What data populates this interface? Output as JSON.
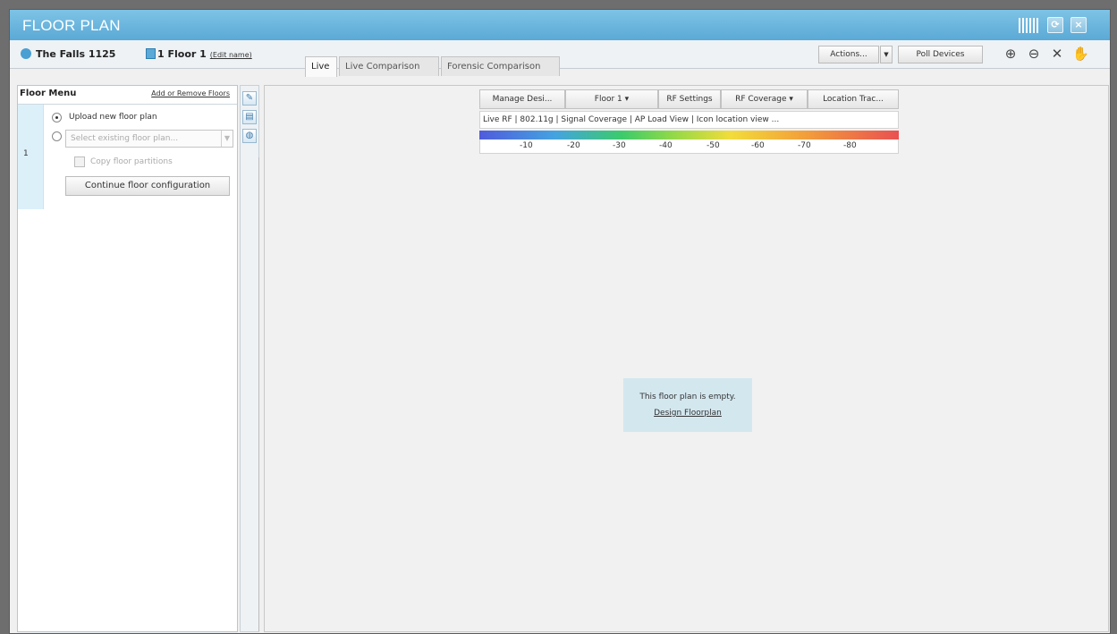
{
  "window": {
    "title": "FLOOR PLAN"
  },
  "toolbar": {
    "site_name": "The Falls 1125",
    "floor_name": "1 Floor 1",
    "edit_name": "(Edit name)",
    "tabs": [
      "Live",
      "Live Comparison",
      "Forensic Comparison"
    ],
    "actions_label": "Actions...",
    "poll_label": "Poll Devices"
  },
  "floor_menu": {
    "title": "Floor Menu",
    "add_remove": "Add or Remove Floors",
    "floor_number": "1",
    "upload_label": "Upload new floor plan",
    "select_placeholder": "Select existing floor plan...",
    "copy_label": "Copy floor partitions",
    "continue_label": "Continue floor configuration"
  },
  "rf_toolbar": {
    "buttons": [
      "Manage Desi...",
      "Floor 1",
      "RF Settings",
      "RF Coverage",
      "Location Trac..."
    ],
    "sub": "Live RF  |  802.11g  |  Signal Coverage  |  AP Load View  |  Icon location view  ...",
    "scale": [
      "-10",
      "-20",
      "-30",
      "-40",
      "-50",
      "-60",
      "-70",
      "-80"
    ]
  },
  "canvas": {
    "empty_msg": "This floor plan is empty.",
    "design_link": "Design Floorplan"
  }
}
